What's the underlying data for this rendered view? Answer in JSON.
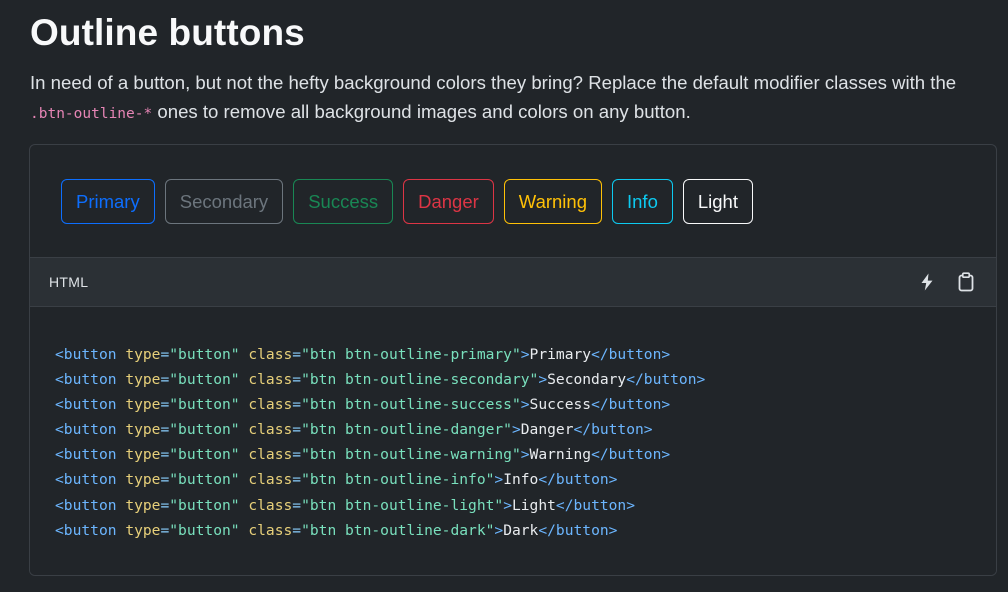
{
  "section": {
    "title": "Outline buttons",
    "intro_before": "In need of a button, but not the hefty background colors they bring? Replace the default modifier classes with the ",
    "intro_code": ".btn-outline-*",
    "intro_after": " ones to remove all background images and colors on any button."
  },
  "buttons": [
    {
      "label": "Primary",
      "variant": "primary",
      "color": "#0d6efd"
    },
    {
      "label": "Secondary",
      "variant": "secondary",
      "color": "#6c757d"
    },
    {
      "label": "Success",
      "variant": "success",
      "color": "#198754"
    },
    {
      "label": "Danger",
      "variant": "danger",
      "color": "#dc3545"
    },
    {
      "label": "Warning",
      "variant": "warning",
      "color": "#ffc107"
    },
    {
      "label": "Info",
      "variant": "info",
      "color": "#0dcaf0"
    },
    {
      "label": "Light",
      "variant": "light",
      "color": "#f8f9fa"
    }
  ],
  "code_panel": {
    "language": "HTML",
    "icons": [
      "lightning-icon",
      "clipboard-icon"
    ]
  },
  "code_lines": [
    {
      "class": "btn btn-outline-primary",
      "text": "Primary"
    },
    {
      "class": "btn btn-outline-secondary",
      "text": "Secondary"
    },
    {
      "class": "btn btn-outline-success",
      "text": "Success"
    },
    {
      "class": "btn btn-outline-danger",
      "text": "Danger"
    },
    {
      "class": "btn btn-outline-warning",
      "text": "Warning"
    },
    {
      "class": "btn btn-outline-info",
      "text": "Info"
    },
    {
      "class": "btn btn-outline-light",
      "text": "Light"
    },
    {
      "class": "btn btn-outline-dark",
      "text": "Dark"
    }
  ],
  "code_tokens": {
    "open_tag": "<",
    "tag_name": "button",
    "attr_type": "type",
    "type_value": "\"button\"",
    "attr_class": "class",
    "equals": "=",
    "close_bracket": ">",
    "close_open": "</"
  },
  "colors": {
    "background": "#212529",
    "code_header_bg": "#2b3035",
    "border": "#3a3f45",
    "inline_code": "#e685b5",
    "tag": "#6cb6ff",
    "attr": "#e7d07a",
    "string": "#79e0bd"
  }
}
